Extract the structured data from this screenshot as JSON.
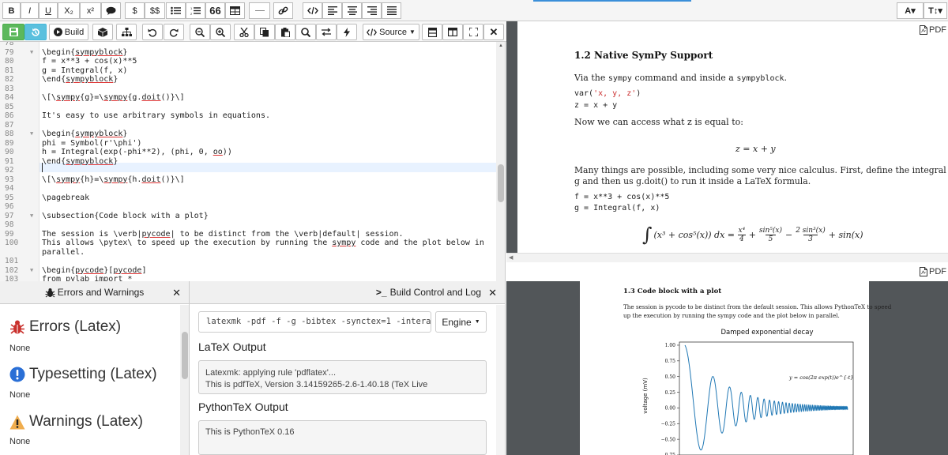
{
  "topbar": {
    "items": [
      "B",
      "I",
      "U",
      "X₂",
      "x²",
      "$",
      "$$",
      "66",
      "A▾",
      "T↕▾"
    ]
  },
  "toolbar": {
    "build_label": "Build",
    "source_label": "Source"
  },
  "editor": {
    "lines": [
      {
        "n": "78",
        "t": "",
        "fold": false
      },
      {
        "n": "79",
        "t": "\\begin{sympyblock}",
        "fold": true
      },
      {
        "n": "80",
        "t": "f = x**3 + cos(x)**5",
        "fold": false
      },
      {
        "n": "81",
        "t": "g = Integral(f, x)",
        "fold": false
      },
      {
        "n": "82",
        "t": "\\end{sympyblock}",
        "fold": false
      },
      {
        "n": "83",
        "t": "",
        "fold": false
      },
      {
        "n": "84",
        "t": "\\[\\sympy{g}=\\sympy{g.doit()}\\]",
        "fold": false
      },
      {
        "n": "85",
        "t": "",
        "fold": false
      },
      {
        "n": "86",
        "t": "It's easy to use arbitrary symbols in equations.",
        "fold": false
      },
      {
        "n": "87",
        "t": "",
        "fold": false
      },
      {
        "n": "88",
        "t": "\\begin{sympyblock}",
        "fold": true
      },
      {
        "n": "89",
        "t": "phi = Symbol(r'\\phi')",
        "fold": false
      },
      {
        "n": "90",
        "t": "h = Integral(exp(-phi**2), (phi, 0, oo))",
        "fold": false
      },
      {
        "n": "91",
        "t": "\\end{sympyblock}",
        "fold": false
      },
      {
        "n": "92",
        "t": "",
        "fold": false
      },
      {
        "n": "93",
        "t": "\\[\\sympy{h}=\\sympy{h.doit()}\\]",
        "fold": false
      },
      {
        "n": "94",
        "t": "",
        "fold": false
      },
      {
        "n": "95",
        "t": "\\pagebreak",
        "fold": false
      },
      {
        "n": "96",
        "t": "",
        "fold": false
      },
      {
        "n": "97",
        "t": "\\subsection{Code block with a plot}",
        "fold": true
      },
      {
        "n": "98",
        "t": "",
        "fold": false
      },
      {
        "n": "99",
        "t": "The session is \\verb|pycode| to be distinct from the \\verb|default| session.",
        "fold": false
      },
      {
        "n": "100",
        "t": "This allows \\pytex\\ to speed up the execution by running the sympy code and the plot below in",
        "fold": false
      },
      {
        "n": "",
        "t": "parallel.",
        "fold": false
      },
      {
        "n": "101",
        "t": "",
        "fold": false
      },
      {
        "n": "102",
        "t": "\\begin{pycode}[pycode]",
        "fold": true
      },
      {
        "n": "103",
        "t": "from pylab import *",
        "fold": false
      }
    ]
  },
  "errors": {
    "title": "Errors and Warnings",
    "sections": [
      {
        "label": "Errors (Latex)",
        "value": "None"
      },
      {
        "label": "Typesetting (Latex)",
        "value": "None"
      },
      {
        "label": "Warnings (Latex)",
        "value": "None"
      }
    ]
  },
  "log": {
    "title": "Build Control and Log",
    "command": "latexmk -pdf -f -g -bibtex -synctex=1 -intera...",
    "engine_label": "Engine",
    "latex_heading": "LaTeX Output",
    "latex_lines": [
      "Latexmk: applying rule 'pdflatex'...",
      "This is pdfTeX, Version 3.14159265-2.6-1.40.18 (TeX Live"
    ],
    "python_heading": "PythonTeX Output",
    "python_lines": [
      "This is PythonTeX 0.16"
    ]
  },
  "pdf1": {
    "label": "PDF",
    "heading": "1.2   Native SymPy Support",
    "p1a": "Via the ",
    "p1b": "sympy",
    "p1c": " command and inside a ",
    "p1d": "sympyblock",
    "code1a": "var(",
    "code1b": "'x, y, z'",
    "code1c": ")",
    "code2": "z = x + y",
    "p2": "Now we can access what z is equal to:",
    "eq1": "z = x + y",
    "p3a": "Many things are possible, including some very nice calculus.  First, define the integral expression",
    "p3b": "g and then us g.doit() to run it inside a LaTeX formula.",
    "code3": "f = x**3 + cos(x)**5",
    "code4": "g = Integral(f, x)"
  },
  "pdf2": {
    "label": "PDF",
    "heading": "1.3   Code block with a plot",
    "p1": "The session is pycode to be distinct from the default session. This allows PythonTeX to speed",
    "p2": "up the execution by running the sympy code and the plot below in parallel."
  },
  "chart_data": {
    "type": "line",
    "title": "Damped exponential decay",
    "xlabel": "",
    "ylabel": "voltage (mV)",
    "annotation": "y = cos(2π exp(t))e^{-t}",
    "ylim": [
      -0.75,
      1.05
    ],
    "yticks": [
      "1.00",
      "0.75",
      "0.50",
      "0.25",
      "0.00",
      "−0.25",
      "−0.50",
      "−0.75"
    ],
    "xlim": [
      0,
      4
    ],
    "function": "cos(2*pi*exp(t))*exp(-t)",
    "color": "#1f77b4"
  }
}
